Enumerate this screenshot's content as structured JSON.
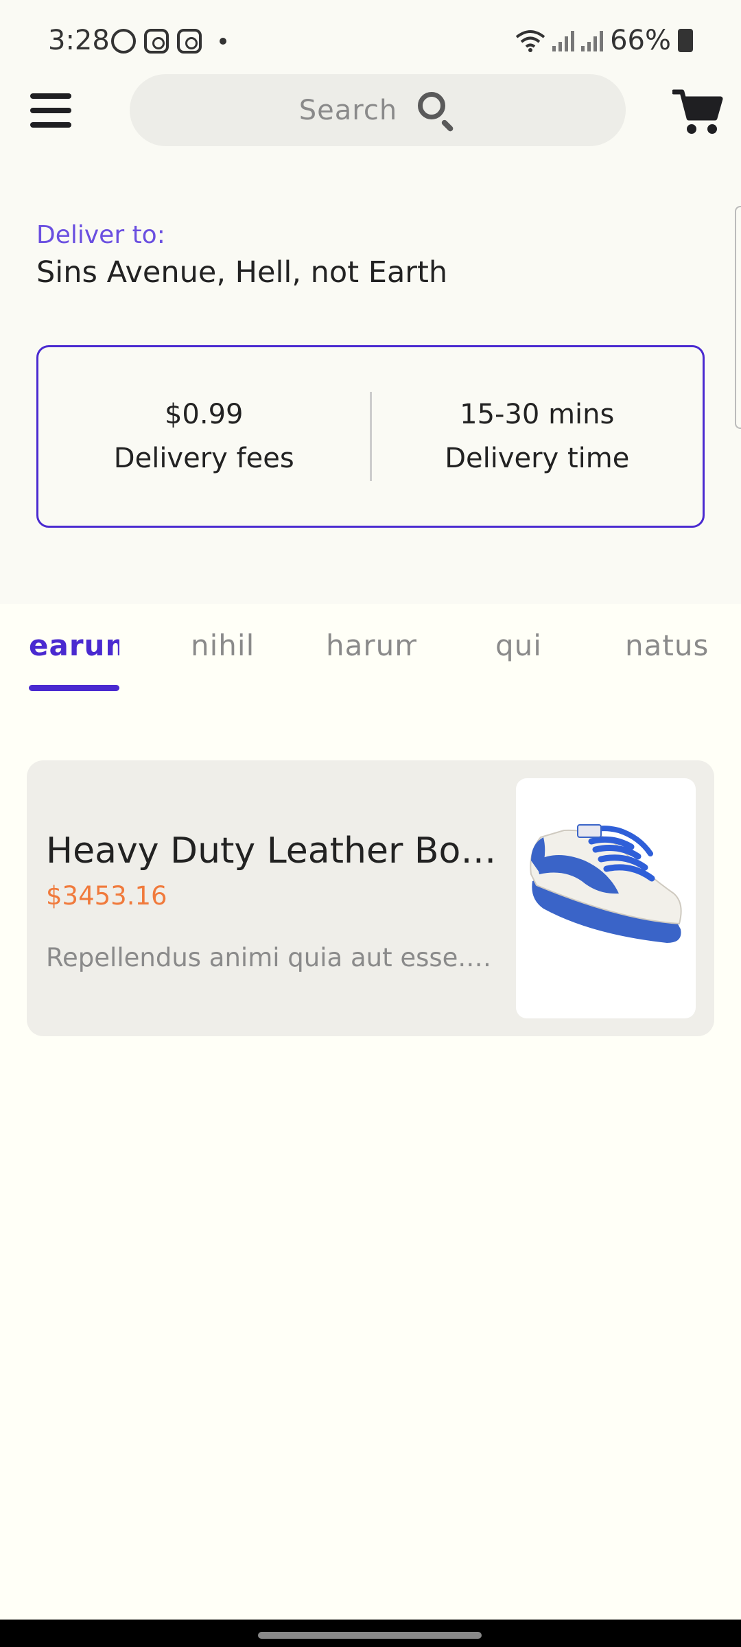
{
  "status_bar": {
    "time": "3:28",
    "battery": "66%"
  },
  "header": {
    "search_placeholder": "Search"
  },
  "delivery": {
    "label": "Deliver to:",
    "address": "Sins Avenue, Hell, not Earth",
    "fee_value": "$0.99",
    "fee_label": "Delivery fees",
    "time_value": "15-30 mins",
    "time_label": "Delivery time"
  },
  "tabs": [
    {
      "label": "earum",
      "active": true
    },
    {
      "label": "nihil",
      "active": false
    },
    {
      "label": "harum",
      "active": false
    },
    {
      "label": "qui",
      "active": false
    },
    {
      "label": "natus",
      "active": false
    }
  ],
  "product": {
    "title": "Heavy Duty Leather Bo…",
    "price": "$3453.16",
    "description": "Repellendus animi quia aut esse.…",
    "image_icon": "sneaker-image"
  },
  "colors": {
    "accent": "#4a2ad0",
    "price": "#f07a3c",
    "deliver_label": "#6a4fe0"
  }
}
